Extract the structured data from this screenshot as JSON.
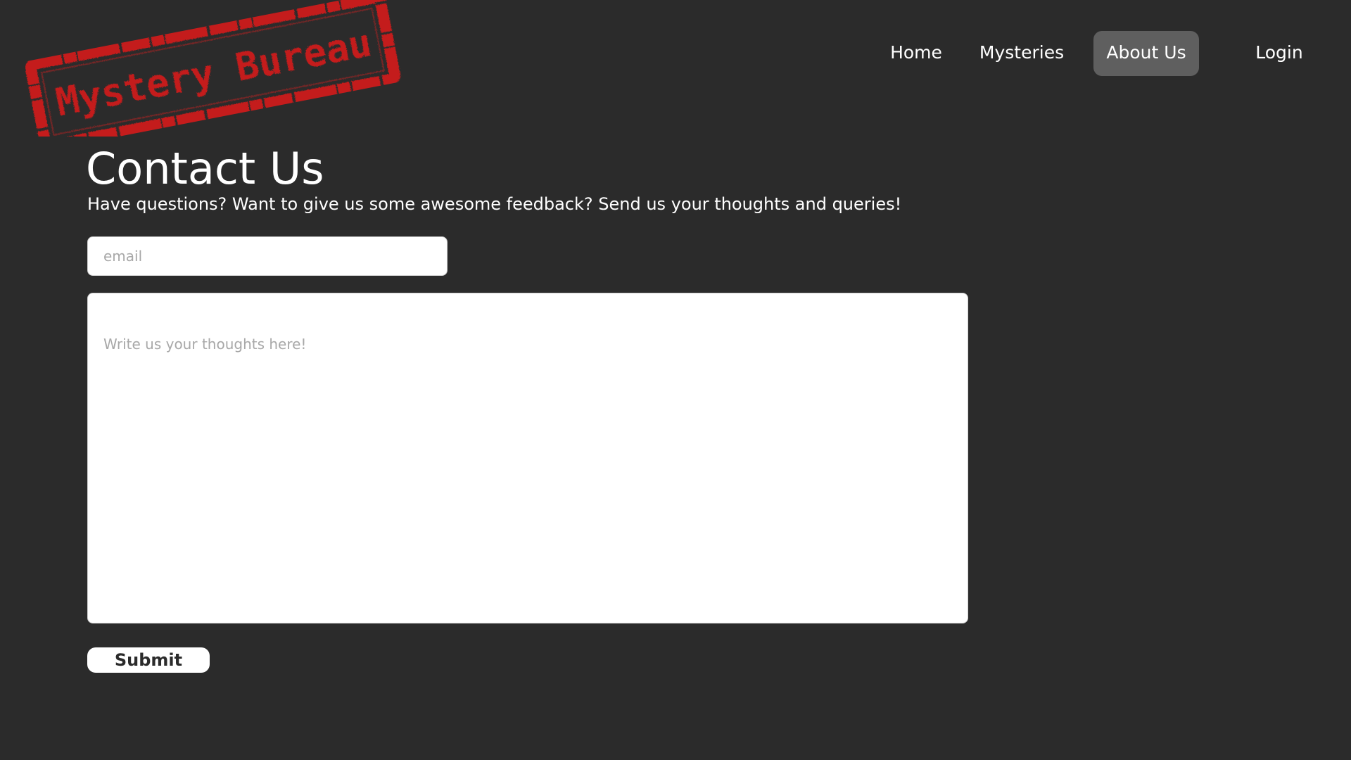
{
  "header": {
    "logo_text": "Mystery Bureau",
    "logo_color": "#c41e1e"
  },
  "nav": {
    "items": [
      {
        "label": "Home",
        "active": false
      },
      {
        "label": "Mysteries",
        "active": false
      },
      {
        "label": "About Us",
        "active": true
      },
      {
        "label": "Login",
        "active": false
      }
    ]
  },
  "main": {
    "title": "Contact Us",
    "subtitle": "Have questions? Want to give us some awesome feedback? Send us your thoughts and queries!"
  },
  "form": {
    "email_placeholder": "email",
    "email_value": "",
    "message_placeholder": "Write us your thoughts here!",
    "message_value": "",
    "submit_label": "Submit"
  },
  "colors": {
    "background": "#2b2b2b",
    "nav_active": "#5f5f5f",
    "stamp_red": "#c41e1e"
  }
}
